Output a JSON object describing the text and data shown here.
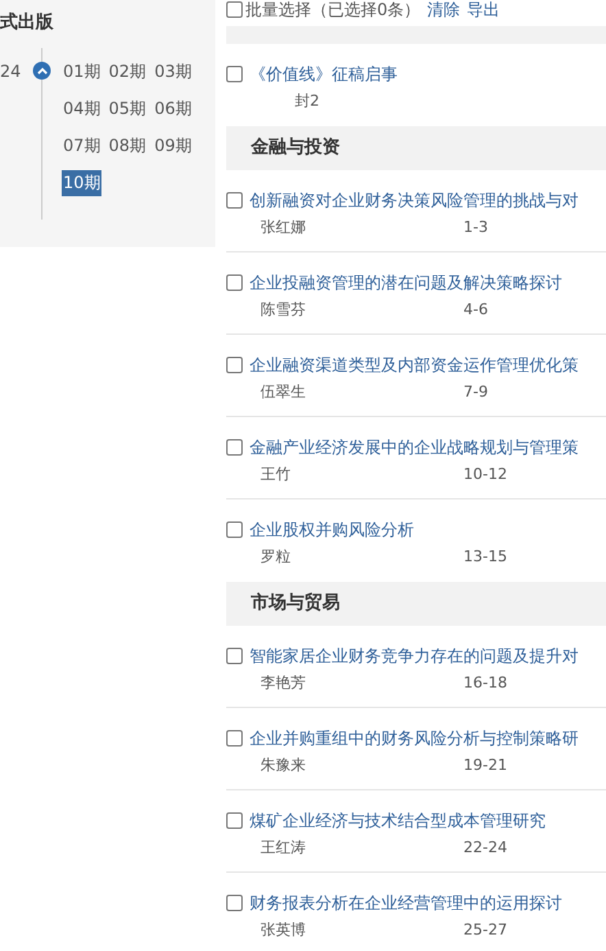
{
  "sidebar": {
    "title": "式出版",
    "year": "24",
    "expanded": true,
    "issues": [
      {
        "label": "01期",
        "selected": false
      },
      {
        "label": "02期",
        "selected": false
      },
      {
        "label": "03期",
        "selected": false
      },
      {
        "label": "04期",
        "selected": false
      },
      {
        "label": "05期",
        "selected": false
      },
      {
        "label": "06期",
        "selected": false
      },
      {
        "label": "07期",
        "selected": false
      },
      {
        "label": "08期",
        "selected": false
      },
      {
        "label": "09期",
        "selected": false
      },
      {
        "label": "10期",
        "selected": true
      }
    ]
  },
  "toolbar": {
    "checked": false,
    "label": "批量选择（已选择0条）",
    "actions": [
      "清除",
      "导出"
    ]
  },
  "sections": [
    {
      "articles": [
        {
          "title": "《价值线》征稿启事",
          "pages": "封2",
          "checked": false
        }
      ]
    },
    {
      "heading": "金融与投资",
      "articles": [
        {
          "title": "创新融资对企业财务决策风险管理的挑战与对",
          "author": "张红娜",
          "pages": "1-3",
          "checked": false
        },
        {
          "title": "企业投融资管理的潜在问题及解决策略探讨",
          "author": "陈雪芬",
          "pages": "4-6",
          "checked": false
        },
        {
          "title": "企业融资渠道类型及内部资金运作管理优化策",
          "author": "伍翠生",
          "pages": "7-9",
          "checked": false
        },
        {
          "title": "金融产业经济发展中的企业战略规划与管理策",
          "author": "王竹",
          "pages": "10-12",
          "checked": false
        },
        {
          "title": "企业股权并购风险分析",
          "author": "罗粒",
          "pages": "13-15",
          "checked": false
        }
      ]
    },
    {
      "heading": "市场与贸易",
      "articles": [
        {
          "title": "智能家居企业财务竞争力存在的问题及提升对",
          "author": "李艳芳",
          "pages": "16-18",
          "checked": false
        },
        {
          "title": "企业并购重组中的财务风险分析与控制策略研",
          "author": "朱豫来",
          "pages": "19-21",
          "checked": false
        },
        {
          "title": "煤矿企业经济与技术结合型成本管理研究",
          "author": "王红涛",
          "pages": "22-24",
          "checked": false
        },
        {
          "title": "财务报表分析在企业经营管理中的运用探讨",
          "author": "张英博",
          "pages": "25-27",
          "checked": false
        }
      ]
    }
  ]
}
